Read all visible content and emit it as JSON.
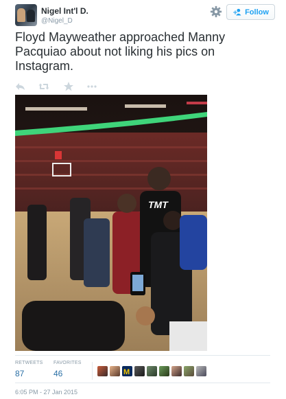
{
  "user": {
    "name": "Nigel Int'l D.",
    "handle": "@Nigel_D"
  },
  "follow_button": {
    "label": "Follow"
  },
  "tweet": {
    "text": "Floyd Mayweather approached Manny Pacquiao about not liking his pics on Instagram."
  },
  "photo": {
    "shirt_text": "TMT"
  },
  "stats": {
    "retweets_label": "RETWEETS",
    "retweets_value": "87",
    "favorites_label": "FAVORITES",
    "favorites_value": "46"
  },
  "timestamp": "6:05 PM - 27 Jan 2015",
  "colors": {
    "link": "#1da1f2",
    "stat_value": "#2a6fa5",
    "meta_gray": "#8899a6",
    "text": "#292f33"
  },
  "icons": [
    "gear-icon",
    "follow-user-icon",
    "reply-icon",
    "retweet-icon",
    "favorite-icon",
    "more-icon"
  ]
}
